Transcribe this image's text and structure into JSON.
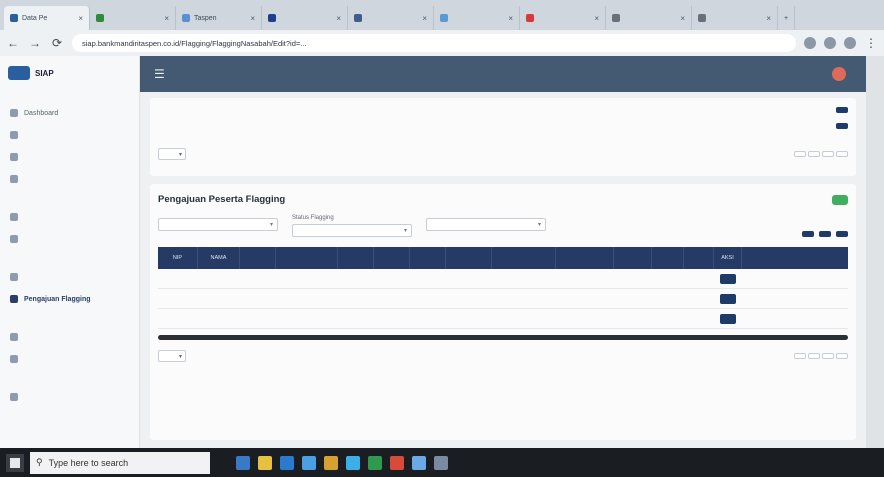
{
  "browser": {
    "tabs": [
      {
        "label": "Data Pe",
        "color": "#2a5e9e",
        "active": true
      },
      {
        "label": "",
        "color": "#2f8a3e"
      },
      {
        "label": "Taspen",
        "color": "#5a8fd4"
      },
      {
        "label": "",
        "color": "#1e3f8a"
      },
      {
        "label": "",
        "color": "#3f5c8a"
      },
      {
        "label": "",
        "color": "#5a9bd4"
      },
      {
        "label": "",
        "color": "#d43a3a"
      },
      {
        "label": "",
        "color": "#6a6f78"
      },
      {
        "label": "",
        "color": "#6a6f78"
      }
    ],
    "url": "siap.bankmandiritaspen.co.id/Flagging/FlaggingNasabah/Edit?id=..."
  },
  "brand": {
    "name": "SIAP",
    "sub": ""
  },
  "sidebar": {
    "sections": [
      {
        "heading": "",
        "items": [
          {
            "label": "Dashboard",
            "icon": "dashboard-icon"
          },
          {
            "label": "",
            "icon": "chart-icon"
          },
          {
            "label": "",
            "icon": "folder-icon"
          },
          {
            "label": "",
            "icon": "user-icon"
          }
        ]
      },
      {
        "heading": "",
        "items": [
          {
            "label": "",
            "icon": "list-icon"
          },
          {
            "label": "",
            "icon": "doc-icon"
          }
        ]
      },
      {
        "heading": "",
        "items": [
          {
            "label": "",
            "icon": "flag-icon"
          },
          {
            "label": "Pengajuan Flagging",
            "icon": "flag-icon",
            "active": true
          }
        ]
      },
      {
        "heading": "",
        "items": [
          {
            "label": "",
            "icon": "report-icon"
          },
          {
            "label": "",
            "icon": "report-icon"
          }
        ]
      },
      {
        "heading": "",
        "items": [
          {
            "label": "",
            "icon": "settings-icon"
          }
        ]
      }
    ]
  },
  "header": {
    "menu_icon": "hamburger-icon",
    "user": ""
  },
  "top_table": {
    "rows": [
      {
        "button": ""
      },
      {
        "button": ""
      }
    ],
    "show_label": "",
    "pager": [
      "",
      "",
      "",
      ""
    ]
  },
  "main": {
    "title": "Pengajuan Peserta Flagging",
    "add_button": "",
    "filters": [
      {
        "label": "",
        "value": ""
      },
      {
        "label": "Status Flagging",
        "value": ""
      },
      {
        "label": "",
        "value": ""
      }
    ],
    "actions": [
      "",
      "",
      ""
    ],
    "columns": [
      "NIP",
      "NAMA",
      "",
      "",
      "",
      "",
      "",
      "",
      "",
      "",
      "",
      "",
      "",
      "AKSI"
    ],
    "rows": [
      {
        "cells": [
          "",
          "",
          "",
          "",
          "",
          "",
          "",
          "",
          "",
          "",
          "",
          "",
          ""
        ]
      },
      {
        "cells": [
          "",
          "",
          "",
          "",
          "",
          "",
          "",
          "",
          "",
          "",
          "",
          "",
          ""
        ]
      },
      {
        "cells": [
          "",
          "",
          "",
          "",
          "",
          "",
          "",
          "",
          "",
          "",
          "",
          "",
          ""
        ]
      }
    ],
    "show_label": "",
    "pager": [
      "",
      "",
      "",
      ""
    ]
  },
  "footer": {
    "text": ""
  },
  "taskbar": {
    "search_placeholder": "Type here to search",
    "tray": ""
  }
}
